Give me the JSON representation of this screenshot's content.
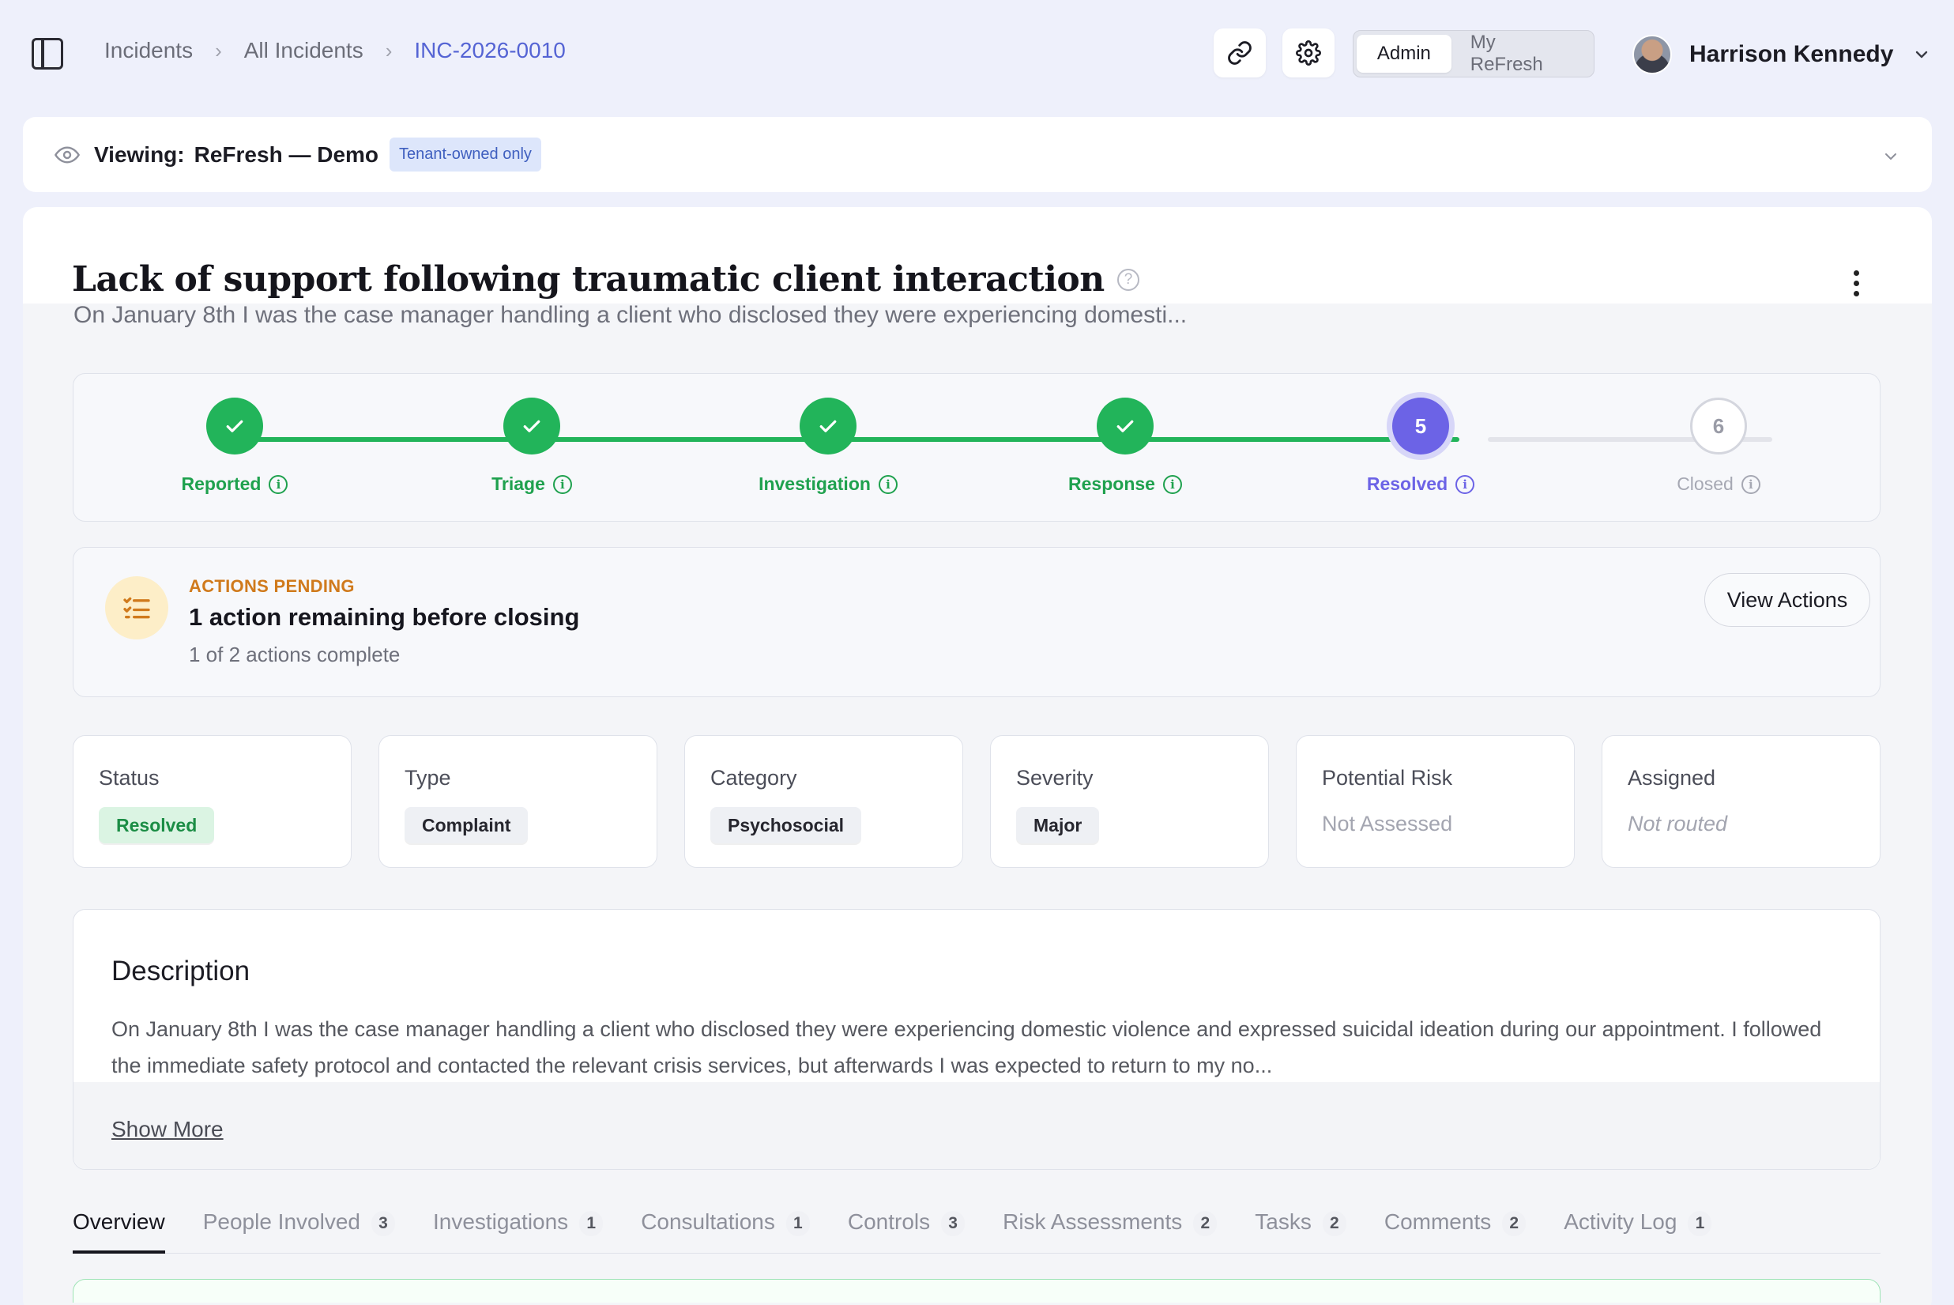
{
  "breadcrumb": {
    "items": [
      "Incidents",
      "All Incidents"
    ],
    "current": "INC-2026-0010"
  },
  "toolbar": {
    "link_icon": "link-icon",
    "settings_icon": "gear-icon"
  },
  "mode_toggle": {
    "options": [
      "Admin",
      "My ReFresh"
    ],
    "selected": "Admin"
  },
  "user": {
    "name": "Harrison Kennedy"
  },
  "viewing": {
    "label": "Viewing:",
    "value": "ReFresh — Demo",
    "badge": "Tenant-owned only"
  },
  "incident": {
    "title": "Lack of support following traumatic client interaction",
    "summary": "On January 8th I was the case manager handling a client who disclosed they were experiencing domesti..."
  },
  "stepper": {
    "steps": [
      {
        "label": "Reported",
        "state": "done"
      },
      {
        "label": "Triage",
        "state": "done"
      },
      {
        "label": "Investigation",
        "state": "done"
      },
      {
        "label": "Response",
        "state": "done"
      },
      {
        "label": "Resolved",
        "state": "current",
        "number": "5"
      },
      {
        "label": "Closed",
        "state": "future",
        "number": "6"
      }
    ]
  },
  "actions_pending": {
    "kicker": "ACTIONS PENDING",
    "heading": "1 action remaining before closing",
    "progress_text": "1 of 2 actions complete",
    "button": "View Actions"
  },
  "stats": {
    "status": {
      "label": "Status",
      "value": "Resolved"
    },
    "type": {
      "label": "Type",
      "value": "Complaint"
    },
    "category": {
      "label": "Category",
      "value": "Psychosocial"
    },
    "severity": {
      "label": "Severity",
      "value": "Major"
    },
    "risk": {
      "label": "Potential Risk",
      "value": "Not Assessed"
    },
    "assigned": {
      "label": "Assigned",
      "value": "Not routed"
    }
  },
  "description": {
    "title": "Description",
    "body": "On January 8th I was the case manager handling a client who disclosed they were experiencing domestic violence and expressed suicidal ideation during our appointment. I followed the immediate safety protocol and contacted the relevant crisis services, but afterwards I was expected to return to my no...",
    "show_more": "Show More"
  },
  "tabs": [
    {
      "label": "Overview",
      "count": ""
    },
    {
      "label": "People Involved",
      "count": "3"
    },
    {
      "label": "Investigations",
      "count": "1"
    },
    {
      "label": "Consultations",
      "count": "1"
    },
    {
      "label": "Controls",
      "count": "3"
    },
    {
      "label": "Risk Assessments",
      "count": "2"
    },
    {
      "label": "Tasks",
      "count": "2"
    },
    {
      "label": "Comments",
      "count": "2"
    },
    {
      "label": "Activity Log",
      "count": "1"
    }
  ],
  "colors": {
    "done": "#22b45a",
    "current": "#6c63e6",
    "accent": "#5564d4",
    "warning": "#d07a1c"
  }
}
